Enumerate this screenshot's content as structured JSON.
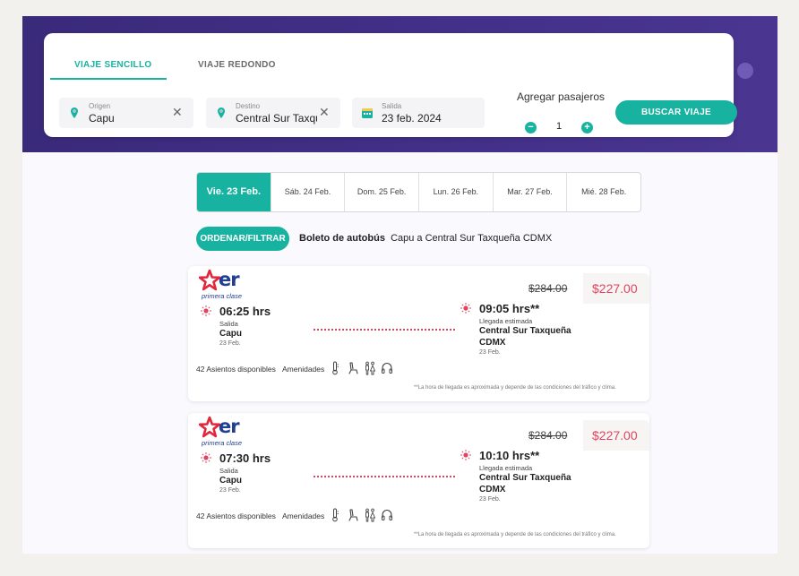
{
  "search": {
    "tabs": [
      {
        "label": "VIAJE SENCILLO",
        "active": true
      },
      {
        "label": "VIAJE REDONDO",
        "active": false
      }
    ],
    "origin": {
      "label": "Origen",
      "value": "Capu"
    },
    "destination": {
      "label": "Destino",
      "value": "Central Sur Taxqueña CDMX"
    },
    "departure": {
      "label": "Salida",
      "value": "23 feb. 2024"
    },
    "passengers": {
      "label": "Agregar pasajeros",
      "count": "1",
      "minus": "−",
      "plus": "+"
    },
    "search_button": "BUSCAR VIAJE",
    "clear_symbol": "✕"
  },
  "dates": [
    {
      "label": "Vie. 23 Feb.",
      "active": true
    },
    {
      "label": "Sáb. 24 Feb.",
      "active": false
    },
    {
      "label": "Dom. 25 Feb.",
      "active": false
    },
    {
      "label": "Lun. 26 Feb.",
      "active": false
    },
    {
      "label": "Mar. 27 Feb.",
      "active": false
    },
    {
      "label": "Mié. 28 Feb.",
      "active": false
    }
  ],
  "filter_button": "ORDENAR/FILTRAR",
  "route": {
    "prefix": "Boleto de autobús",
    "text": "Capu a Central Sur Taxqueña CDMX"
  },
  "trips": [
    {
      "brand": "er",
      "brand_sub": "primera clase",
      "old_price": "$284.00",
      "price": "$227.00",
      "depart_time": "06:25 hrs",
      "depart_label": "Salida",
      "depart_place": "Capu",
      "depart_date": "23 Feb.",
      "arrive_time": "09:05 hrs**",
      "arrive_label": "Llegada estimada",
      "arrive_place_1": "Central Sur Taxqueña",
      "arrive_place_2": "CDMX",
      "arrive_date": "23 Feb.",
      "seats": "42 Asientos disponibles",
      "amenities_label": "Amenidades",
      "disclaimer": "**La hora de llegada es aproximada y depende de las condiciones del tráfico y clima."
    },
    {
      "brand": "er",
      "brand_sub": "primera clase",
      "old_price": "$284.00",
      "price": "$227.00",
      "depart_time": "07:30 hrs",
      "depart_label": "Salida",
      "depart_place": "Capu",
      "depart_date": "23 Feb.",
      "arrive_time": "10:10 hrs**",
      "arrive_label": "Llegada estimada",
      "arrive_place_1": "Central Sur Taxqueña",
      "arrive_place_2": "CDMX",
      "arrive_date": "23 Feb.",
      "seats": "42 Asientos disponibles",
      "amenities_label": "Amenidades",
      "disclaimer": "**La hora de llegada es aproximada y depende de las condiciones del tráfico y clima."
    }
  ],
  "amenity_icons": [
    "thermometer-icon",
    "seat-icon",
    "restroom-icon",
    "headphones-icon"
  ],
  "colors": {
    "accent": "#17b3a0",
    "hero": "#3a2a7a",
    "price": "#e0445e",
    "brand": "#1f3e94",
    "brand_star": "#e3263a"
  }
}
